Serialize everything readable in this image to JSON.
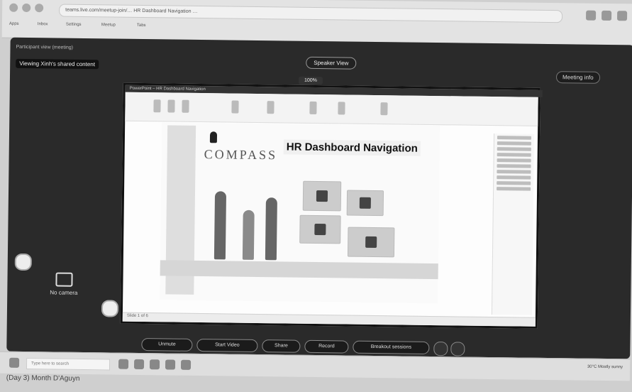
{
  "browser": {
    "url_text": "teams.live.com/meetup-join/… HR Dashboard Navigation …",
    "bookmarks": [
      "Apps",
      "Inbox",
      "Settings",
      "Meetup",
      "Tabs"
    ]
  },
  "meeting": {
    "info": "Participant view (meeting)",
    "viewing_label": "Viewing Xinh's shared content",
    "speaker_mode": "Speaker View",
    "zoom_level": "100%",
    "camera_label": "No camera",
    "top_right": {
      "actions_label": "Meeting info"
    }
  },
  "shared_screen": {
    "app_bar": "PowerPoint – HR Dashboard Navigation",
    "slide": {
      "logo_text": "COMPASS",
      "title": "HR Dashboard Navigation"
    },
    "status_text": "Slide 1 of 6"
  },
  "controls": {
    "unmute": "Unmute",
    "start_video": "Start Video",
    "share": "Share",
    "record": "Record",
    "breakout": "Breakout sessions"
  },
  "taskbar": {
    "search_placeholder": "Type here to search",
    "weather": "30°C Mostly sunny"
  },
  "caption": "(Day 3) Month D'Aguyn"
}
